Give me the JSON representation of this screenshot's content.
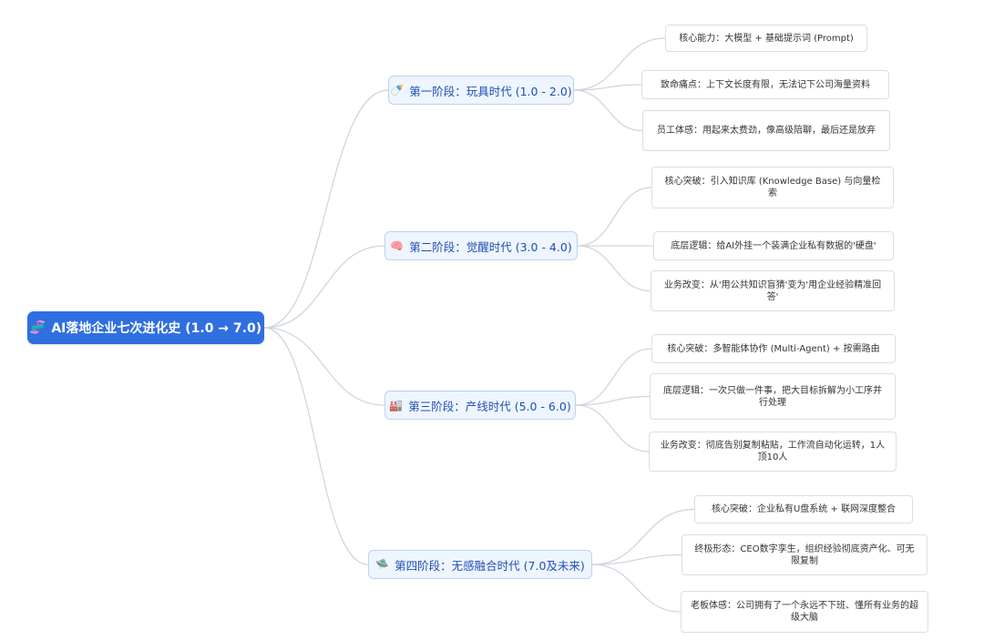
{
  "root": {
    "icon": "🧬",
    "label": "AI落地企业七次进化史 (1.0 → 7.0)"
  },
  "stages": [
    {
      "icon": "🍼",
      "label": "第一阶段：玩具时代 (1.0 - 2.0)",
      "items": [
        "核心能力：大模型 + 基础提示词 (Prompt)",
        "致命痛点：上下文长度有限，无法记下公司海量资料",
        "员工体感：用起来太费劲，像高级陪聊，最后还是放弃"
      ]
    },
    {
      "icon": "🧠",
      "label": "第二阶段：觉醒时代 (3.0 - 4.0)",
      "items": [
        "核心突破：引入知识库 (Knowledge Base) 与向量检索",
        "底层逻辑：给AI外挂一个装满企业私有数据的'硬盘'",
        "业务改变：从'用公共知识盲猜'变为'用企业经验精准回答'"
      ]
    },
    {
      "icon": "🏭",
      "label": "第三阶段：产线时代 (5.0 - 6.0)",
      "items": [
        "核心突破：多智能体协作 (Multi-Agent) + 按需路由",
        "底层逻辑：一次只做一件事，把大目标拆解为小工序并行处理",
        "业务改变：彻底告别复制粘贴，工作流自动化运转，1人顶10人"
      ]
    },
    {
      "icon": "🛸",
      "label": "第四阶段：无感融合时代 (7.0及未来)",
      "items": [
        "核心突破：企业私有U盘系统 + 联网深度整合",
        "终极形态：CEO数字孪生，组织经验彻底资产化、可无限复制",
        "老板体感：公司拥有了一个永远不下班、懂所有业务的超级大脑"
      ]
    }
  ]
}
